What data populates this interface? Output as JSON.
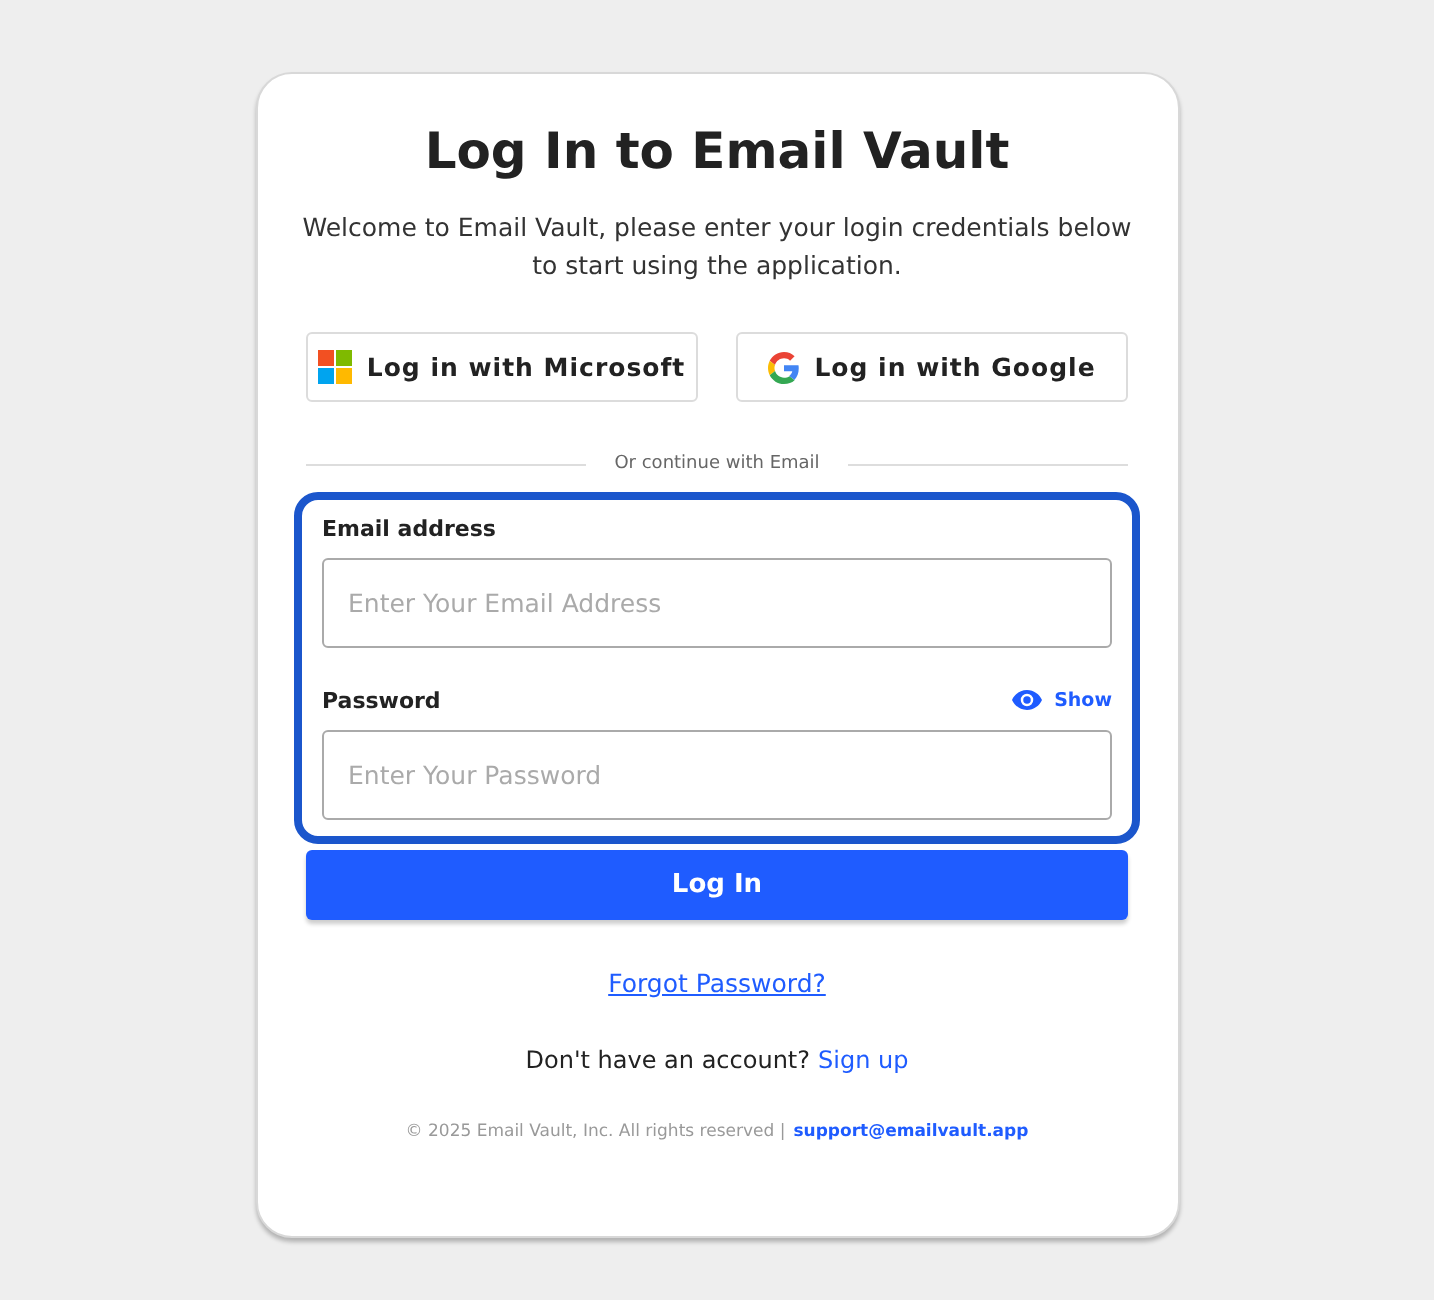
{
  "title": "Log In to Email Vault",
  "intro": "Welcome to Email Vault, please enter your login credentials below to start using the application.",
  "social_buttons": [
    {
      "kind": "microsoft",
      "label": "Log in with Microsoft"
    },
    {
      "kind": "google",
      "label": "Log in with Google"
    }
  ],
  "divider": "Or continue with Email",
  "fields_group": {
    "highlighted": true,
    "fields": [
      {
        "label": "Email address",
        "placeholder": "Enter Your Email Address"
      },
      {
        "label": "Password",
        "placeholder": "Enter Your Password",
        "toggle": "Show"
      }
    ]
  },
  "submit": "Log In",
  "forgot_link": "Forgot Password?",
  "signup": {
    "text": "Don't have an account?",
    "link": "Sign up"
  },
  "footer": {
    "text": "© 2025 Email Vault, Inc. All rights reserved |",
    "link": "support@emailvault.app"
  }
}
